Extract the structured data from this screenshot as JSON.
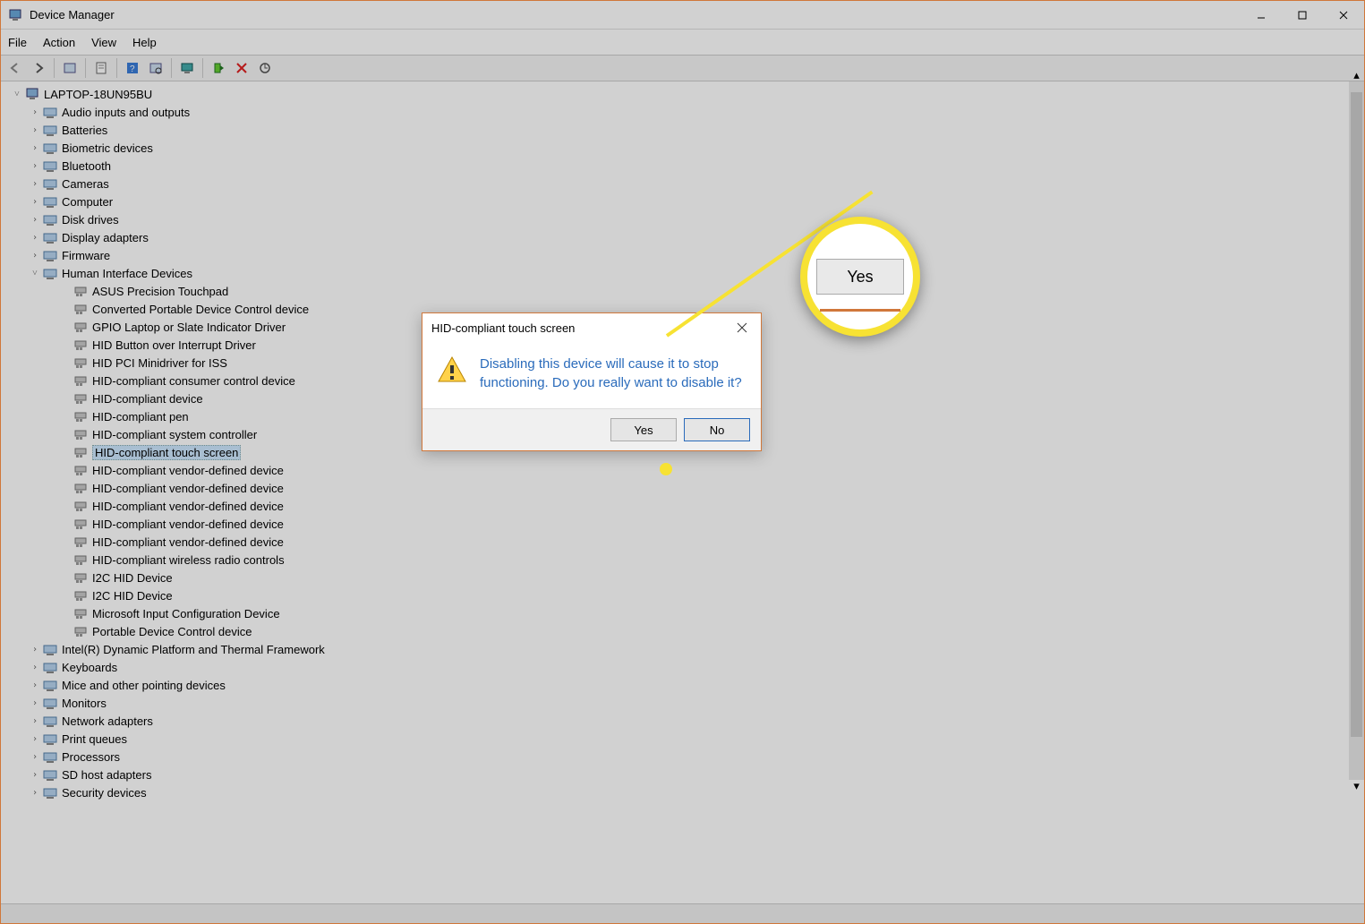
{
  "window": {
    "title": "Device Manager"
  },
  "menu": {
    "file": "File",
    "action": "Action",
    "view": "View",
    "help": "Help"
  },
  "toolbar_icons": {
    "back": "back-arrow-icon",
    "forward": "forward-arrow-icon",
    "show_hidden": "show-hidden-devices-icon",
    "properties": "properties-icon",
    "help": "help-icon",
    "scan": "scan-hardware-icon",
    "monitor": "show-all-devices-icon",
    "enable": "enable-device-icon",
    "disable": "disable-device-icon",
    "update": "update-driver-icon"
  },
  "tree": {
    "root": "LAPTOP-18UN95BU",
    "categories": [
      {
        "label": "Audio inputs and outputs",
        "expanded": false
      },
      {
        "label": "Batteries",
        "expanded": false
      },
      {
        "label": "Biometric devices",
        "expanded": false
      },
      {
        "label": "Bluetooth",
        "expanded": false
      },
      {
        "label": "Cameras",
        "expanded": false
      },
      {
        "label": "Computer",
        "expanded": false
      },
      {
        "label": "Disk drives",
        "expanded": false
      },
      {
        "label": "Display adapters",
        "expanded": false
      },
      {
        "label": "Firmware",
        "expanded": false
      },
      {
        "label": "Human Interface Devices",
        "expanded": true,
        "children": [
          "ASUS Precision Touchpad",
          "Converted Portable Device Control device",
          "GPIO Laptop or Slate Indicator Driver",
          "HID Button over Interrupt Driver",
          "HID PCI Minidriver for ISS",
          "HID-compliant consumer control device",
          "HID-compliant device",
          "HID-compliant pen",
          "HID-compliant system controller",
          "HID-compliant touch screen",
          "HID-compliant vendor-defined device",
          "HID-compliant vendor-defined device",
          "HID-compliant vendor-defined device",
          "HID-compliant vendor-defined device",
          "HID-compliant vendor-defined device",
          "HID-compliant wireless radio controls",
          "I2C HID Device",
          "I2C HID Device",
          "Microsoft Input Configuration Device",
          "Portable Device Control device"
        ],
        "selected_child_index": 9
      },
      {
        "label": "Intel(R) Dynamic Platform and Thermal Framework",
        "expanded": false
      },
      {
        "label": "Keyboards",
        "expanded": false
      },
      {
        "label": "Mice and other pointing devices",
        "expanded": false
      },
      {
        "label": "Monitors",
        "expanded": false
      },
      {
        "label": "Network adapters",
        "expanded": false
      },
      {
        "label": "Print queues",
        "expanded": false
      },
      {
        "label": "Processors",
        "expanded": false
      },
      {
        "label": "SD host adapters",
        "expanded": false
      },
      {
        "label": "Security devices",
        "expanded": false
      }
    ]
  },
  "dialog": {
    "title": "HID-compliant touch screen",
    "message": "Disabling this device will cause it to stop functioning. Do you really want to disable it?",
    "yes": "Yes",
    "no": "No"
  },
  "callout": {
    "label": "Yes"
  }
}
